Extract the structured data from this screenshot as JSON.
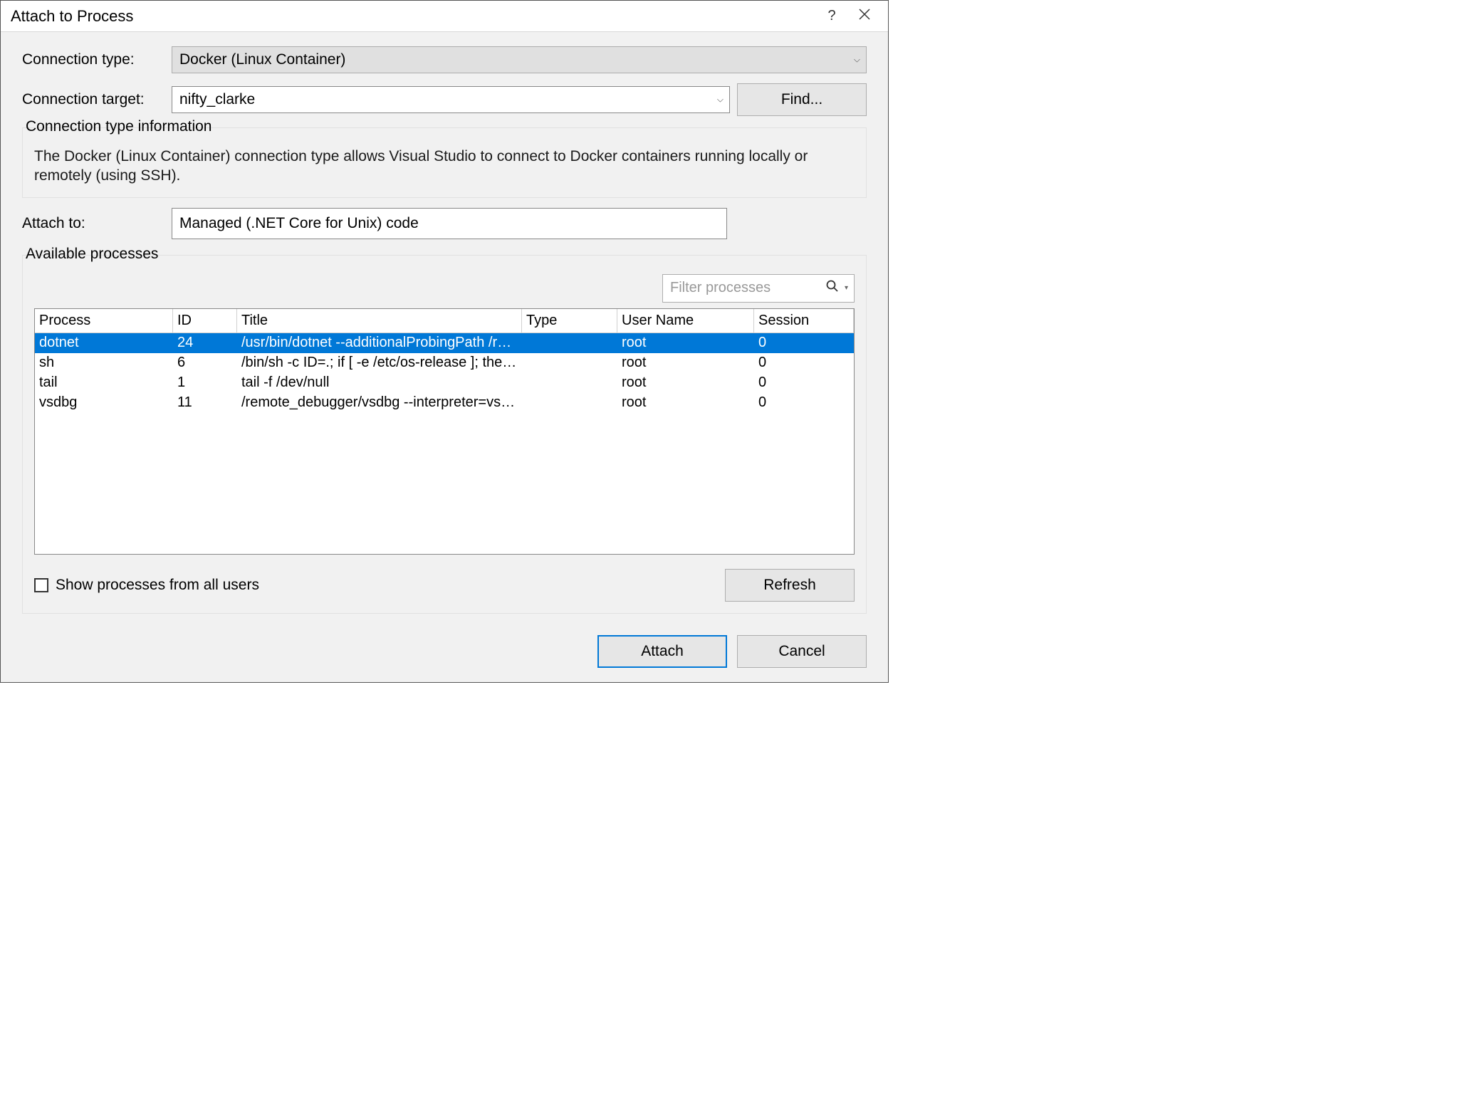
{
  "window": {
    "title": "Attach to Process"
  },
  "labels": {
    "connection_type": "Connection type:",
    "connection_target": "Connection target:",
    "attach_to": "Attach to:",
    "info_heading": "Connection type information",
    "available": "Available processes",
    "show_all": "Show processes from all users"
  },
  "connection": {
    "type_value": "Docker (Linux Container)",
    "target_value": "nifty_clarke",
    "find_label": "Find...",
    "info_text": "The Docker (Linux Container) connection type allows Visual Studio to connect to Docker containers running locally or remotely (using SSH)."
  },
  "attach": {
    "value": "Managed (.NET Core for Unix) code"
  },
  "filter": {
    "placeholder": "Filter processes"
  },
  "table": {
    "headers": {
      "process": "Process",
      "id": "ID",
      "title": "Title",
      "type": "Type",
      "user": "User Name",
      "session": "Session"
    },
    "rows": [
      {
        "process": "dotnet",
        "id": "24",
        "title": "/usr/bin/dotnet --additionalProbingPath /root...",
        "type": "",
        "user": "root",
        "session": "0",
        "selected": true
      },
      {
        "process": "sh",
        "id": "6",
        "title": "/bin/sh -c ID=.; if [ -e /etc/os-release ]; then . /...",
        "type": "",
        "user": "root",
        "session": "0",
        "selected": false
      },
      {
        "process": "tail",
        "id": "1",
        "title": "tail -f /dev/null",
        "type": "",
        "user": "root",
        "session": "0",
        "selected": false
      },
      {
        "process": "vsdbg",
        "id": "11",
        "title": "/remote_debugger/vsdbg --interpreter=vscode",
        "type": "",
        "user": "root",
        "session": "0",
        "selected": false
      }
    ]
  },
  "buttons": {
    "refresh": "Refresh",
    "attach": "Attach",
    "cancel": "Cancel"
  }
}
